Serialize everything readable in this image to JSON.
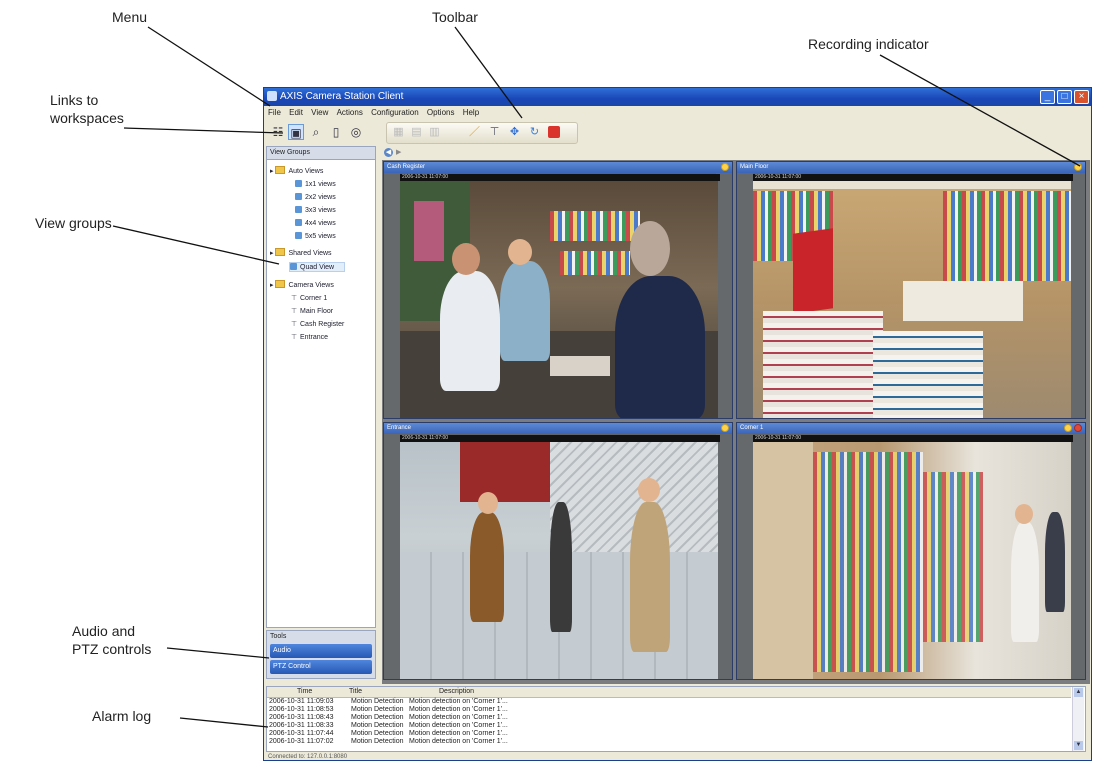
{
  "callouts": {
    "menu": "Menu",
    "toolbar": "Toolbar",
    "recording_indicator": "Recording indicator",
    "links_line1": "Links to",
    "links_line2": "workspaces",
    "view_groups": "View groups",
    "audio_line1": "Audio and",
    "audio_line2": "PTZ controls",
    "alarm_log": "Alarm log"
  },
  "window": {
    "title": "AXIS Camera Station Client",
    "menu": [
      "File",
      "Edit",
      "View",
      "Actions",
      "Configuration",
      "Options",
      "Help"
    ]
  },
  "workspace_icons": [
    "live-view-icon",
    "search-icon",
    "recordings-icon",
    "configuration-icon"
  ],
  "toolbar_icons": [
    "snapshot-icon",
    "record-icon",
    "layout-icon",
    "pen-icon",
    "camera-icon",
    "ptz-icon",
    "refresh-icon",
    "stop-icon"
  ],
  "left_panel": {
    "header": "View Groups",
    "auto_views": "Auto Views",
    "auto_view_items": [
      "1x1 views",
      "2x2 views",
      "3x3 views",
      "4x4 views",
      "5x5 views"
    ],
    "shared_views": "Shared Views",
    "quad_view": "Quad View",
    "camera_views": "Camera Views",
    "cameras": [
      "Corner 1",
      "Main Floor",
      "Cash Register",
      "Entrance"
    ]
  },
  "tools": {
    "header": "Tools",
    "audio": "Audio",
    "ptz": "PTZ Control"
  },
  "cameras": [
    {
      "title": "Cash Register",
      "timestamp": "2006-10-31 11:07:00"
    },
    {
      "title": "Main Floor",
      "timestamp": "2006-10-31 11:07:00"
    },
    {
      "title": "Entrance",
      "timestamp": "2006-10-31 11:07:00"
    },
    {
      "title": "Corner 1",
      "timestamp": "2006-10-31 11:07:00"
    }
  ],
  "alarm_log": {
    "columns": [
      "Time",
      "Title",
      "Description"
    ],
    "rows": [
      {
        "time": "2006-10-31 11:09:03",
        "title": "Motion Detection",
        "description": "Motion detection on 'Corner 1'..."
      },
      {
        "time": "2006-10-31 11:08:53",
        "title": "Motion Detection",
        "description": "Motion detection on 'Corner 1'..."
      },
      {
        "time": "2006-10-31 11:08:43",
        "title": "Motion Detection",
        "description": "Motion detection on 'Corner 1'..."
      },
      {
        "time": "2006-10-31 11:08:33",
        "title": "Motion Detection",
        "description": "Motion detection on 'Corner 1'..."
      },
      {
        "time": "2006-10-31 11:07:44",
        "title": "Motion Detection",
        "description": "Motion detection on 'Corner 1'..."
      },
      {
        "time": "2006-10-31 11:07:02",
        "title": "Motion Detection",
        "description": "Motion detection on 'Corner 1'..."
      }
    ]
  },
  "status": "Connected to: 127.0.0.1:8080",
  "colors": {
    "titlebar": "#1947b8",
    "camera_bar": "#3a64b8",
    "recording": "#ffd24a"
  }
}
